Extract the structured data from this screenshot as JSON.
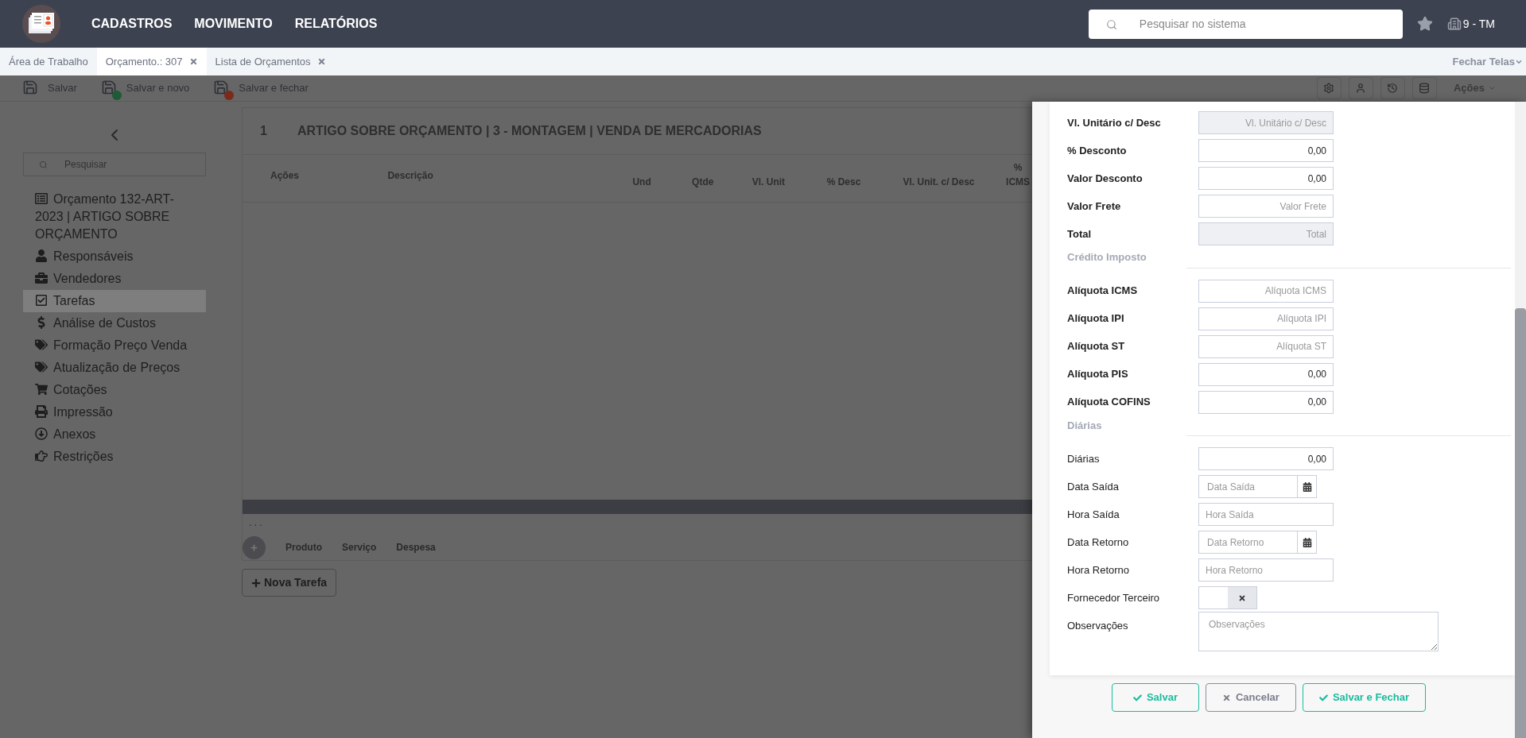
{
  "top_bar": {
    "menu": [
      "CADASTROS",
      "MOVIMENTO",
      "RELATÓRIOS"
    ],
    "search": {
      "placeholder": "Pesquisar no sistema"
    },
    "company": "9 - TM"
  },
  "tabs": [
    {
      "label": "Área de Trabalho",
      "selected": false,
      "closable": false
    },
    {
      "label": "Orçamento.: 307",
      "selected": true,
      "closable": true
    },
    {
      "label": "Lista de Orçamentos",
      "selected": false,
      "closable": true
    }
  ],
  "close_screens": "Fechar Telas",
  "toolbar": {
    "buttons": [
      {
        "label": "Salvar",
        "kind": "save"
      },
      {
        "label": "Salvar e novo",
        "kind": "save_new"
      },
      {
        "label": "Salvar e fechar",
        "kind": "save_close"
      }
    ],
    "actions": "Ações"
  },
  "sidebar": {
    "search": {
      "placeholder": "Pesquisar"
    },
    "items": [
      {
        "label": "Orçamento 132-ART-2023 | ARTIGO SOBRE ORÇAMENTO",
        "kind": "document",
        "selected": false
      },
      {
        "label": "Responsáveis",
        "kind": "person",
        "selected": false
      },
      {
        "label": "Vendedores",
        "kind": "briefcase",
        "selected": false
      },
      {
        "label": "Tarefas",
        "kind": "tasks",
        "selected": true
      },
      {
        "label": "Análise de Custos",
        "kind": "money",
        "selected": false
      },
      {
        "label": "Formação Preço Venda",
        "kind": "tags",
        "selected": false
      },
      {
        "label": "Atualização de Preços",
        "kind": "tags",
        "selected": false
      },
      {
        "label": "Cotações",
        "kind": "cart",
        "selected": false
      },
      {
        "label": "Impressão",
        "kind": "print",
        "selected": false
      },
      {
        "label": "Anexos",
        "kind": "download",
        "selected": false
      },
      {
        "label": "Restrições",
        "kind": "hand",
        "selected": false
      }
    ]
  },
  "task": {
    "number": "1",
    "title": "ARTIGO SOBRE ORÇAMENTO | 3 - MONTAGEM | VENDA DE MERCADORIAS",
    "columns": [
      "Ações",
      "Descrição",
      "Und",
      "Qtde",
      "Vl. Unit",
      "% Desc",
      "Vl. Unit. c/ Desc",
      "% ICMS"
    ],
    "more": ". . .",
    "item_tabs": [
      "Produto",
      "Serviço",
      "Despesa"
    ]
  },
  "new_task_button": "Nova Tarefa",
  "drawer": {
    "sections": [
      {
        "emphasized": true,
        "fields": [
          {
            "label": "Vl. Unitário c/ Desc",
            "kind": "readonly",
            "placeholder": "Vl. Unitário c/ Desc"
          },
          {
            "label": "% Desconto",
            "kind": "number",
            "value": "0,00"
          },
          {
            "label": "Valor Desconto",
            "kind": "number",
            "value": "0,00"
          },
          {
            "label": "Valor Frete",
            "kind": "number",
            "placeholder": "Valor Frete"
          },
          {
            "label": "Total",
            "kind": "readonly",
            "placeholder": "Total"
          }
        ]
      },
      {
        "title": "Crédito Imposto",
        "emphasized": true,
        "fields": [
          {
            "label": "Alíquota ICMS",
            "kind": "number",
            "placeholder": "Alíquota ICMS"
          },
          {
            "label": "Alíquota IPI",
            "kind": "number",
            "placeholder": "Alíquota IPI"
          },
          {
            "label": "Alíquota ST",
            "kind": "number",
            "placeholder": "Alíquota ST"
          },
          {
            "label": "Alíquota PIS",
            "kind": "number",
            "value": "0,00"
          },
          {
            "label": "Alíquota COFINS",
            "kind": "number",
            "value": "0,00"
          }
        ]
      },
      {
        "title": "Diárias",
        "emphasized": false,
        "fields": [
          {
            "label": "Diárias",
            "kind": "number",
            "value": "0,00"
          },
          {
            "label": "Data Saída",
            "kind": "date",
            "placeholder": "Data Saída"
          },
          {
            "label": "Hora Saída",
            "kind": "text",
            "placeholder": "Hora Saída"
          },
          {
            "label": "Data Retorno",
            "kind": "date",
            "placeholder": "Data Retorno"
          },
          {
            "label": "Hora Retorno",
            "kind": "text",
            "placeholder": "Hora Retorno"
          },
          {
            "label": "Fornecedor Terceiro",
            "kind": "toggle",
            "on": false
          },
          {
            "label": "Observações",
            "kind": "textarea",
            "placeholder": "Observações"
          }
        ]
      }
    ],
    "buttons": [
      {
        "label": "Salvar",
        "kind": "confirm"
      },
      {
        "label": "Cancelar",
        "kind": "cancel"
      },
      {
        "label": "Salvar e Fechar",
        "kind": "confirm"
      }
    ]
  }
}
